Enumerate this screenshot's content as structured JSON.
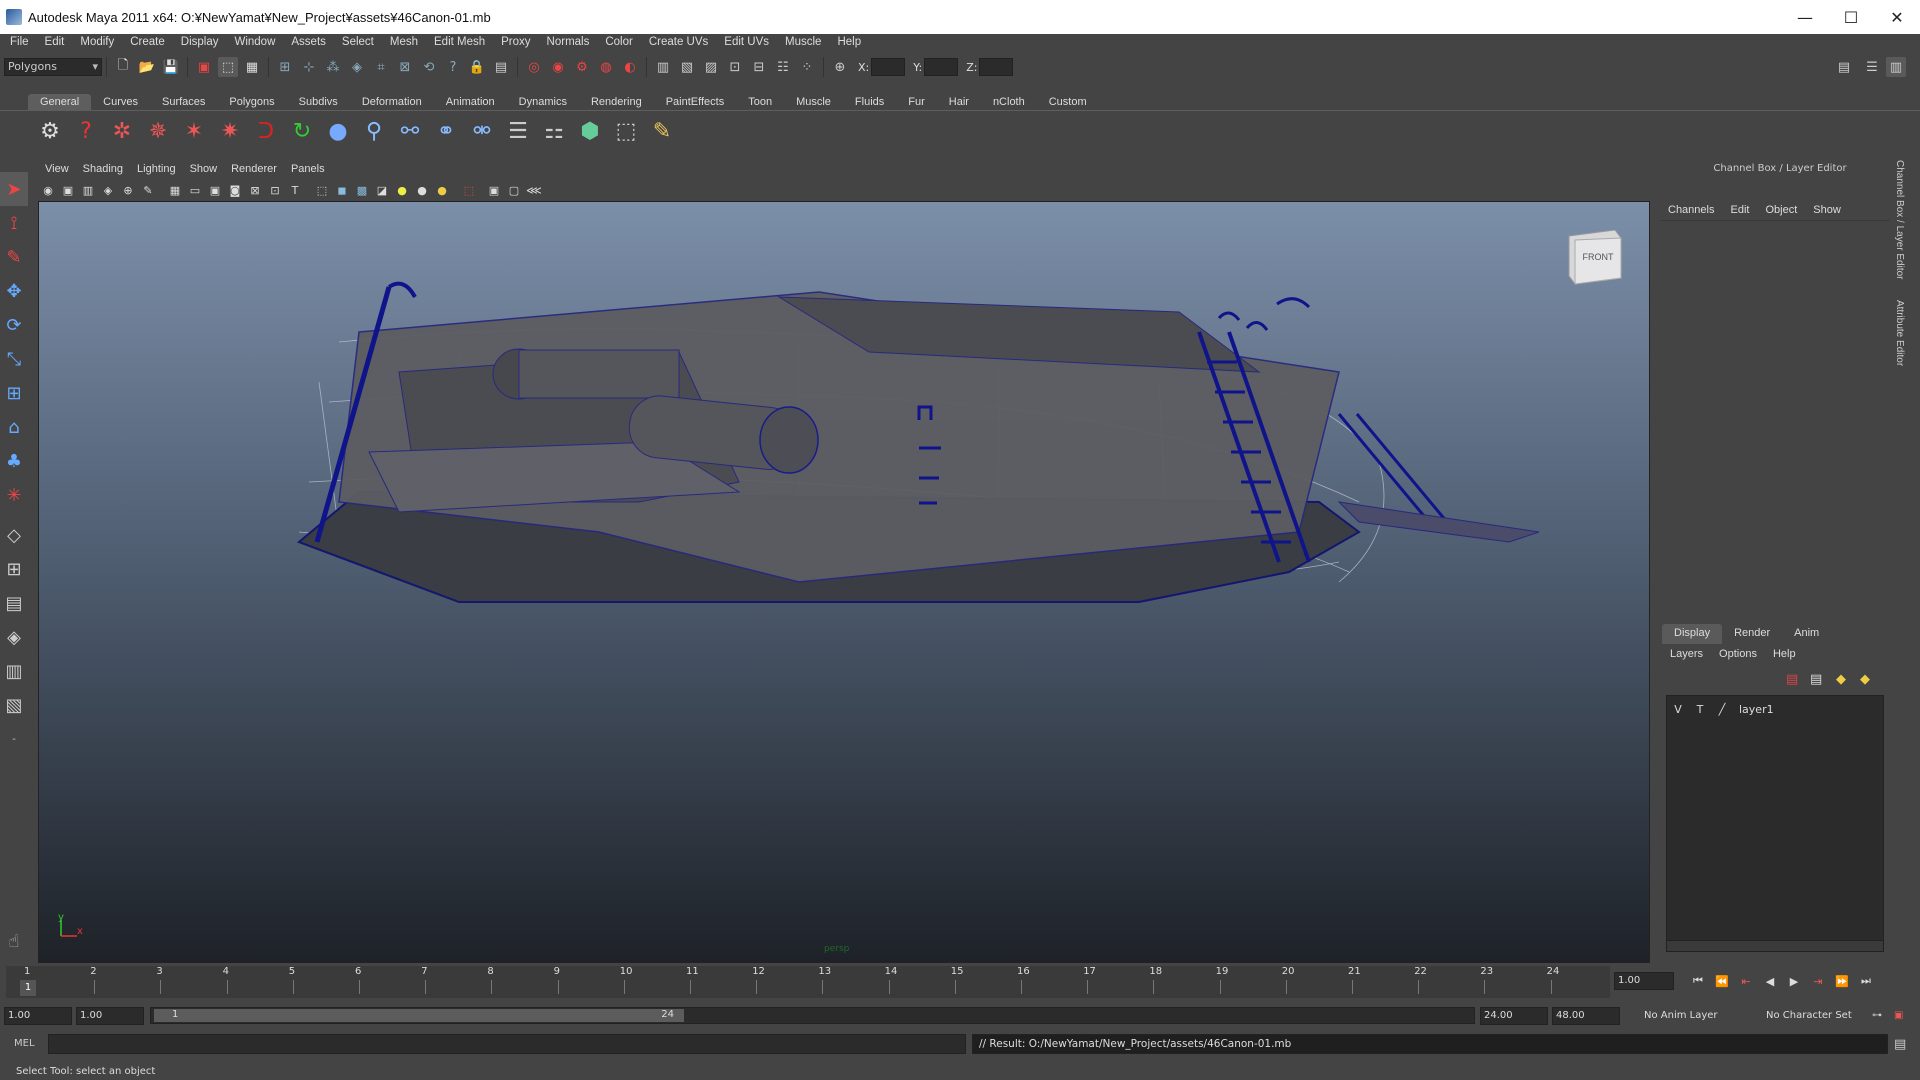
{
  "window": {
    "title": "Autodesk Maya 2011 x64: O:¥NewYamat¥New_Project¥assets¥46Canon-01.mb",
    "minimize": "—",
    "maximize": "☐",
    "close": "✕"
  },
  "menus": [
    "File",
    "Edit",
    "Modify",
    "Create",
    "Display",
    "Window",
    "Assets",
    "Select",
    "Mesh",
    "Edit Mesh",
    "Proxy",
    "Normals",
    "Color",
    "Create UVs",
    "Edit UVs",
    "Muscle",
    "Help"
  ],
  "status_line": {
    "mode": "Polygons",
    "x_label": "X:",
    "y_label": "Y:",
    "z_label": "Z:"
  },
  "shelf": {
    "tabs": [
      "General",
      "Curves",
      "Surfaces",
      "Polygons",
      "Subdivs",
      "Deformation",
      "Animation",
      "Dynamics",
      "Rendering",
      "PaintEffects",
      "Toon",
      "Muscle",
      "Fluids",
      "Fur",
      "Hair",
      "nCloth",
      "Custom"
    ],
    "active_tab": "General"
  },
  "viewport": {
    "menus": [
      "View",
      "Shading",
      "Lighting",
      "Show",
      "Renderer",
      "Panels"
    ],
    "viewcube_label": "FRONT",
    "camera_label": "persp",
    "axis_y": "y",
    "axis_x": "x"
  },
  "channel_box": {
    "header": "Channel Box / Layer Editor",
    "menus": [
      "Channels",
      "Edit",
      "Object",
      "Show"
    ],
    "side_tabs": [
      "Channel Box / Layer Editor",
      "Attribute Editor"
    ]
  },
  "layer_editor": {
    "tabs": [
      "Display",
      "Render",
      "Anim"
    ],
    "active_tab": "Display",
    "menus": [
      "Layers",
      "Options",
      "Help"
    ],
    "layers": [
      {
        "v": "V",
        "t": "T",
        "name": "layer1"
      }
    ]
  },
  "timeline": {
    "ticks": [
      "1",
      "2",
      "3",
      "4",
      "5",
      "6",
      "7",
      "8",
      "9",
      "10",
      "11",
      "12",
      "13",
      "14",
      "15",
      "16",
      "17",
      "18",
      "19",
      "20",
      "21",
      "22",
      "23",
      "24"
    ],
    "current_frame": "1",
    "current_frame_field": "1.00"
  },
  "range": {
    "start_time": "1.00",
    "playback_start": "1.00",
    "slider_start": "1",
    "slider_end": "24",
    "playback_end": "24.00",
    "end_time": "48.00",
    "anim_layer": "No Anim Layer",
    "character_set": "No Character Set"
  },
  "command_line": {
    "label": "MEL",
    "result": "// Result: O:/NewYamat/New_Project/assets/46Canon-01.mb"
  },
  "help_line": "Select Tool: select an object"
}
